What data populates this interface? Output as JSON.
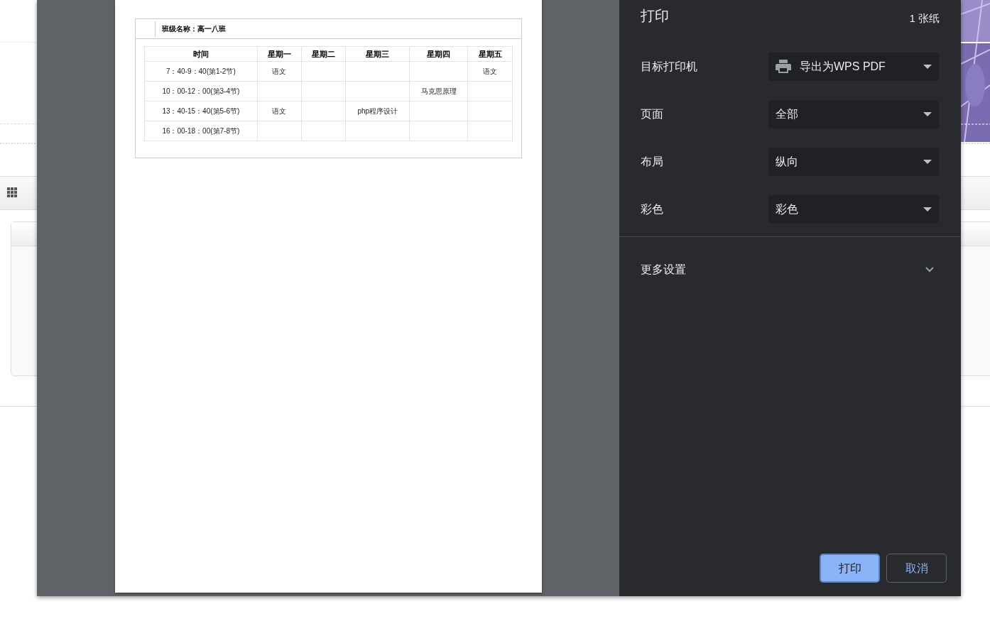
{
  "preview": {
    "class_label": "班级名称：高一八班",
    "table": {
      "columns": [
        "时间",
        "星期一",
        "星期二",
        "星期三",
        "星期四",
        "星期五"
      ],
      "rows": [
        [
          "7：40-9：40(第1-2节)",
          "语文",
          "",
          "",
          "",
          "语文"
        ],
        [
          "10：00-12：00(第3-4节)",
          "",
          "",
          "",
          "马克思原理",
          ""
        ],
        [
          "13：40-15：40(第5-6节)",
          "语文",
          "",
          "php程序设计",
          "",
          ""
        ],
        [
          "16：00-18：00(第7-8节)",
          "",
          "",
          "",
          "",
          ""
        ]
      ]
    }
  },
  "settings": {
    "title": "打印",
    "sheet_count": "1 张纸",
    "fields": [
      {
        "label": "目标打印机",
        "value": "导出为WPS PDF",
        "kind": "printer"
      },
      {
        "label": "页面",
        "value": "全部",
        "kind": "select"
      },
      {
        "label": "布局",
        "value": "纵向",
        "kind": "select"
      },
      {
        "label": "彩色",
        "value": "彩色",
        "kind": "select"
      }
    ],
    "more_settings": {
      "label": "更多设置",
      "expanded": false
    },
    "buttons": [
      {
        "label": "打印",
        "kind": "primary"
      },
      {
        "label": "取消",
        "kind": "secondary"
      }
    ]
  }
}
